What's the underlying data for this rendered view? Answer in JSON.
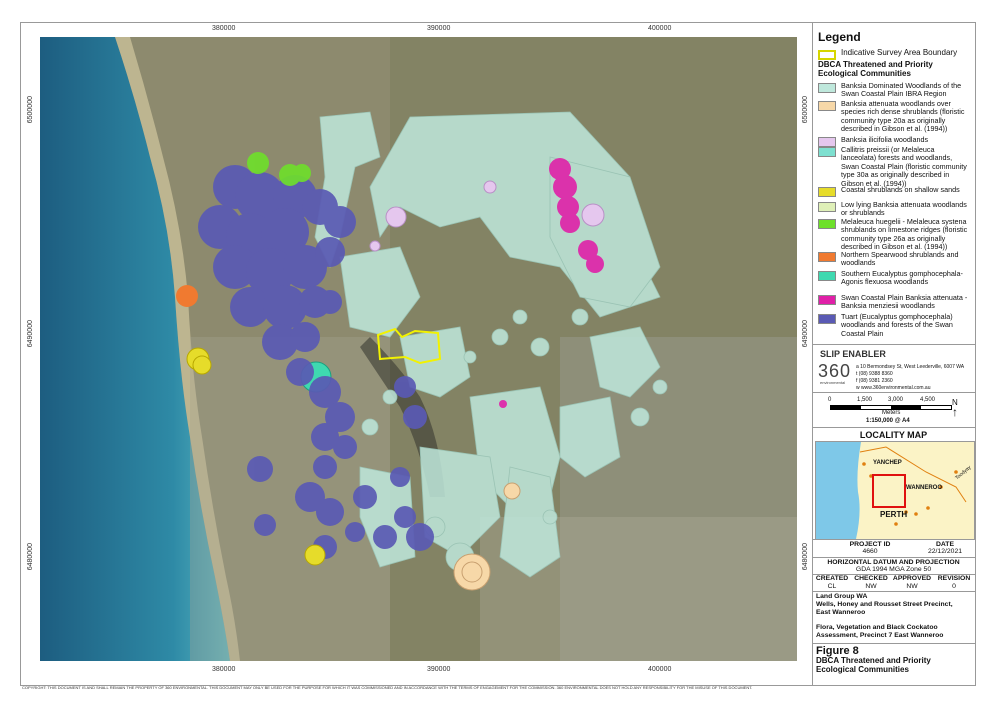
{
  "map_coords": {
    "top": [
      "380000",
      "390000",
      "400000"
    ],
    "bottom": [
      "380000",
      "390000",
      "400000"
    ],
    "left": [
      "6500000",
      "6490000",
      "6480000"
    ],
    "right": [
      "6500000",
      "6490000",
      "6480000"
    ]
  },
  "legend": {
    "title": "Legend",
    "boundary_label": "Indicative Survey Area Boundary",
    "section_title": "DBCA Threatened and Priority Ecological Communities",
    "items": [
      {
        "label": "Banksia Dominated Woodlands of the Swan Coastal Plain IBRA Region",
        "color": "#bfe8dc"
      },
      {
        "label": "Banksia attenuata woodlands over species rich dense shrublands (floristic community type 20a as originally described in Gibson et al. (1994))",
        "color": "#f7d8a8"
      },
      {
        "label": "Banksia ilicifolia woodlands",
        "color": "#e5c7ee"
      },
      {
        "label": "Callitris preissii (or Melaleuca lanceolata) forests and woodlands, Swan Coastal Plain (floristic community type 30a as originally described in Gibson et al. (1994))",
        "color": "#7ee0d0"
      },
      {
        "label": "Coastal shrublands on shallow sands",
        "color": "#e6dc2a"
      },
      {
        "label": "Low lying Banksia attenuata woodlands or shrublands",
        "color": "#dff0b8"
      },
      {
        "label": "Melaleuca huegelii - Melaleuca systena shrublands on limestone ridges (floristic community type 26a as originally described in Gibson et al. (1994))",
        "color": "#6ee02a"
      },
      {
        "label": "Northern Spearwood shrublands and woodlands",
        "color": "#f07a30"
      },
      {
        "label": "Southern Eucalyptus gomphocephala-Agonis flexuosa woodlands",
        "color": "#3fd9b0"
      },
      {
        "label": "Swan Coastal Plain Banksia attenuata - Banksia menziesii woodlands",
        "color": "#e020a8"
      },
      {
        "label": "Tuart (Eucalyptus gomphocephala) woodlands and forests of the Swan Coastal Plain",
        "color": "#5a5ab4"
      }
    ]
  },
  "logos": {
    "slip": "SLIP ENABLER",
    "company": "360",
    "company_sub": "environmental",
    "address": "a 10 Bermondsey St, West Leederville, 6007 WA",
    "phone": "t (08) 9388 8360",
    "fax": "f (08) 9381 2360",
    "web": "w www.360environmental.com.au"
  },
  "scale": {
    "ticks": [
      "0",
      "1,500",
      "3,000",
      "4,500"
    ],
    "unit": "Meters",
    "ratio": "1:150,000 @ A4",
    "north": "N"
  },
  "locality": {
    "title": "LOCALITY MAP",
    "places": [
      "YANCHEP",
      "WANNEROO",
      "PERTH",
      "Toodyay"
    ]
  },
  "project": {
    "id_label": "PROJECT ID",
    "id": "4660",
    "date_label": "DATE",
    "date": "22/12/2021",
    "datum_label": "HORIZONTAL DATUM AND PROJECTION",
    "datum": "GDA 1994 MGA Zone 50",
    "created_label": "CREATED",
    "created": "CL",
    "checked_label": "CHECKED",
    "checked": "NW",
    "approved_label": "APPROVED",
    "approved": "NW",
    "revision_label": "REVISION",
    "revision": "0"
  },
  "client": {
    "name": "Land Group WA",
    "site": "Wells, Honey and Rousset Street Precinct, East Wanneroo",
    "report": "Flora, Vegetation and Black Cockatoo Assessment, Precinct 7 East Wanneroo"
  },
  "figure": {
    "number": "Figure 8",
    "title": "DBCA Threatened and Priority Ecological Communities"
  },
  "copyright": "COPYRIGHT: THIS DOCUMENT IS AND SHALL REMAIN THE PROPERTY OF 360 ENVIRONMENTAL. THIS DOCUMENT MAY ONLY BE USED FOR THE PURPOSE FOR WHICH IT WAS COMMISSIONED AND IN ACCORDANCE WITH THE TERMS OF ENGAGEMENT FOR THE COMMISSION. 360 ENVIRONMENTAL DOES NOT HOLD ANY RESPONSIBILITY FOR THE MISUSE OF THIS DOCUMENT."
}
